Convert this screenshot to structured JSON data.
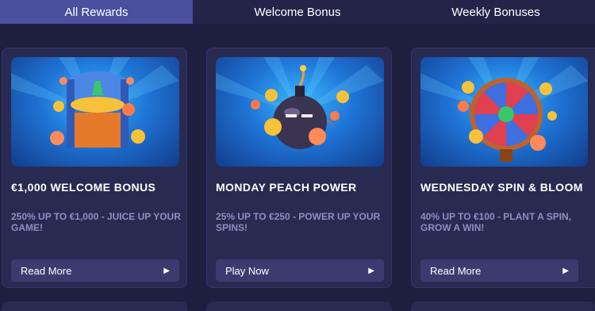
{
  "tabs": [
    {
      "label": "All Rewards",
      "active": true
    },
    {
      "label": "Welcome Bonus",
      "active": false
    },
    {
      "label": "Weekly Bonuses",
      "active": false
    }
  ],
  "cards": [
    {
      "title": "€1,000 WELCOME BONUS",
      "description": "250% UP TO €1,000 - JUICE UP YOUR GAME!",
      "button": "Read More",
      "image_icon": "treasure-chest-icon"
    },
    {
      "title": "MONDAY PEACH POWER",
      "description": "25% UP TO €250 - POWER UP YOUR SPINS!",
      "button": "Play Now",
      "image_icon": "bomb-icon"
    },
    {
      "title": "WEDNESDAY SPIN & BLOOM",
      "description": "40% UP TO €100 - PLANT A SPIN, GROW A WIN!",
      "button": "Read More",
      "image_icon": "prize-wheel-icon"
    }
  ],
  "colors": {
    "background": "#1e1e3e",
    "card": "#292a52",
    "active_tab": "#4a4f9e",
    "button": "#3a3c70",
    "description_text": "#8d8fc1"
  }
}
